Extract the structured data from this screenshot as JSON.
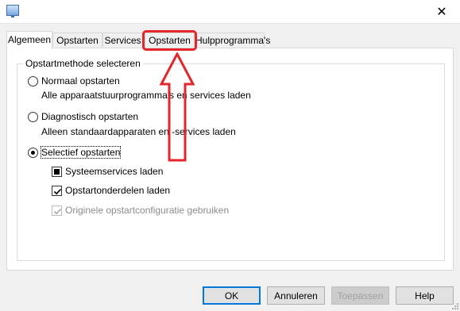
{
  "window": {
    "close_glyph": "✕",
    "icon": "msconfig-icon"
  },
  "tabs": [
    {
      "label": "Algemeen",
      "active": true
    },
    {
      "label": "Opstarten"
    },
    {
      "label": "Services"
    },
    {
      "label": "Opstarten",
      "highlighted": true
    },
    {
      "label": "Hulpprogramma's"
    }
  ],
  "group": {
    "legend": "Opstartmethode selecteren"
  },
  "options": {
    "normal": {
      "label": "Normaal opstarten",
      "desc": "Alle apparaatstuurprogramma's en services laden",
      "checked": false
    },
    "diagnostic": {
      "label": "Diagnostisch opstarten",
      "desc": "Alleen standaardapparaten en -services laden",
      "checked": false
    },
    "selective": {
      "label": "Selectief opstarten",
      "checked": true
    }
  },
  "checkboxes": {
    "system_services": {
      "label": "Systeemservices laden",
      "state": "indeterminate"
    },
    "startup_items": {
      "label": "Opstartonderdelen laden",
      "state": "checked"
    },
    "original_config": {
      "label": "Originele opstartconfiguratie gebruiken",
      "state": "checked",
      "disabled": true
    }
  },
  "buttons": {
    "ok": "OK",
    "cancel": "Annuleren",
    "apply": "Toepassen",
    "help": "Help"
  },
  "colors": {
    "annotation": "#e2262c",
    "accent": "#0078d7"
  }
}
